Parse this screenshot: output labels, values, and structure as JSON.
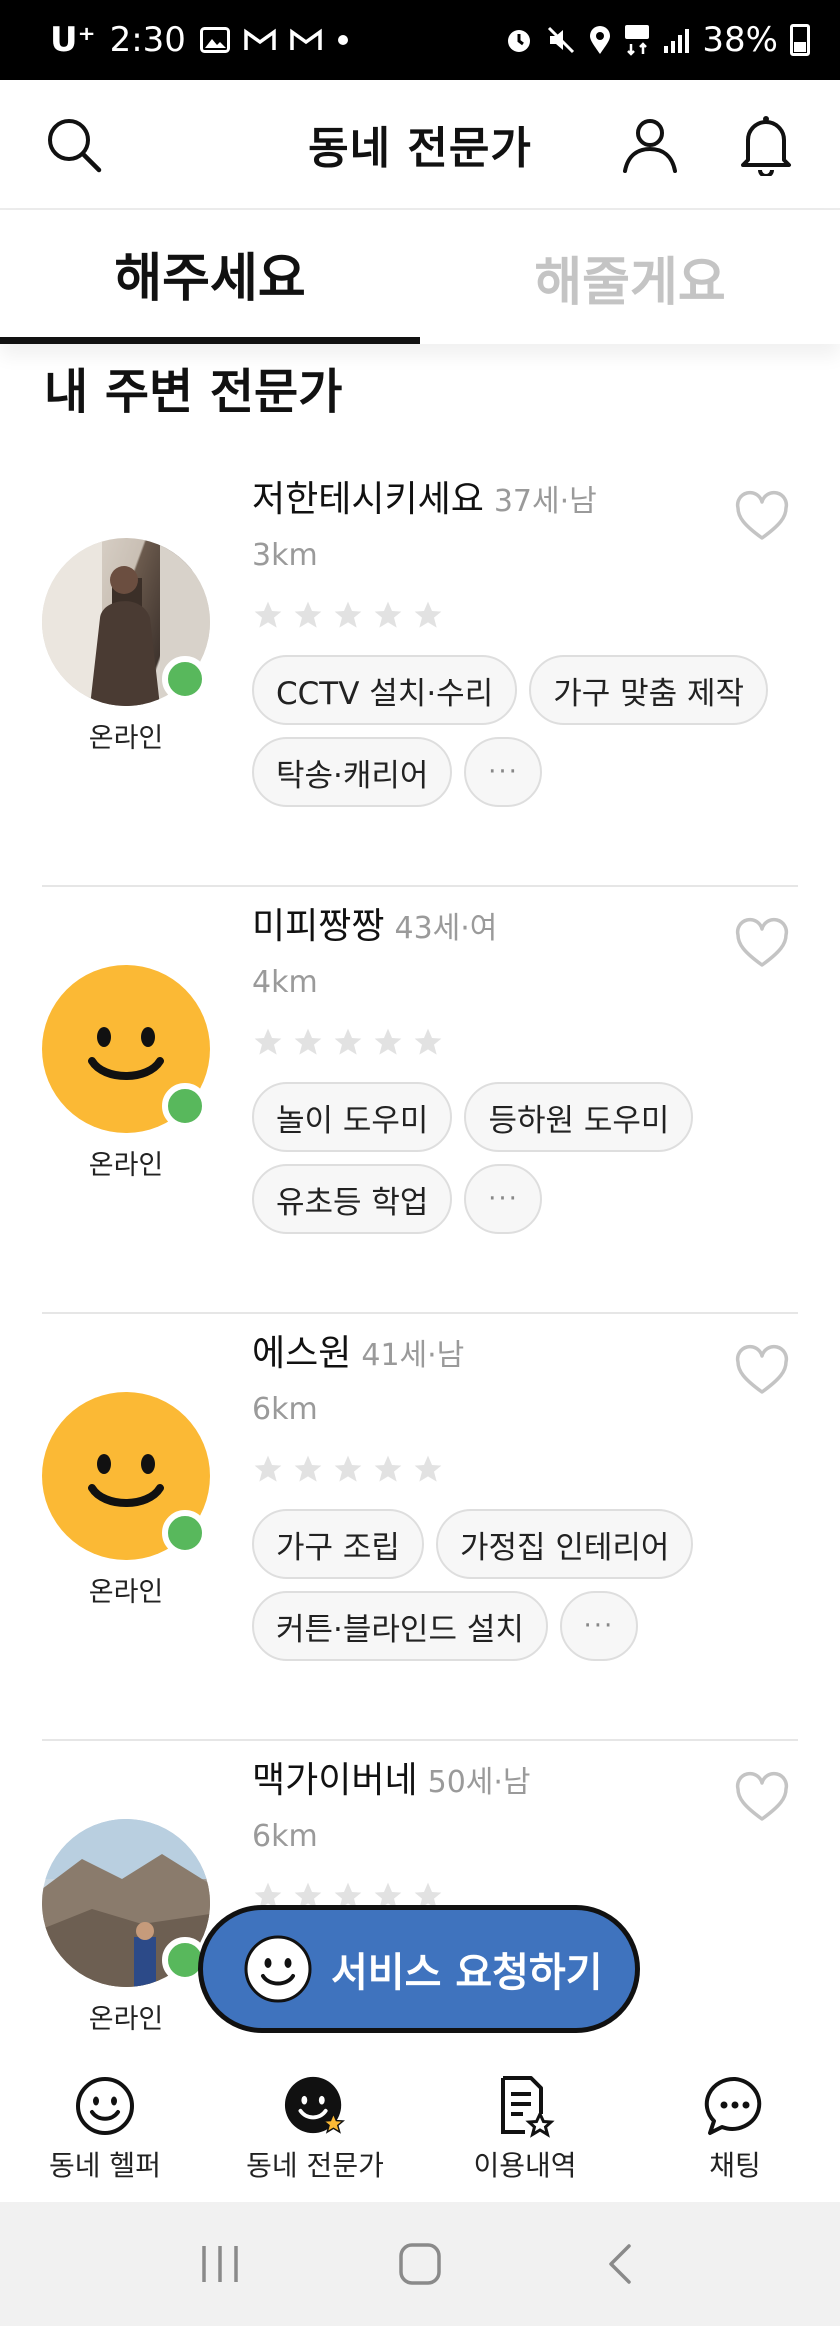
{
  "status_bar": {
    "carrier": "U⁺",
    "time": "2:30",
    "battery": "38%"
  },
  "header": {
    "title": "동네 전문가"
  },
  "tabs": [
    {
      "label": "해주세요",
      "active": true
    },
    {
      "label": "해줄게요",
      "active": false
    }
  ],
  "section_title": "내 주변 전문가",
  "experts": [
    {
      "name": "저한테시키세요",
      "meta": "37세·남",
      "distance": "3km",
      "status": "온라인",
      "avatar": "photo",
      "rating": 0,
      "chips": [
        "CCTV 설치·수리",
        "가구 맞춤 제작",
        "탁송·캐리어"
      ]
    },
    {
      "name": "미피짱짱",
      "meta": "43세·여",
      "distance": "4km",
      "status": "온라인",
      "avatar": "smile",
      "rating": 0,
      "chips": [
        "놀이 도우미",
        "등하원 도우미",
        "유초등 학업"
      ]
    },
    {
      "name": "에스원",
      "meta": "41세·남",
      "distance": "6km",
      "status": "온라인",
      "avatar": "smile",
      "rating": 0,
      "chips": [
        "가구 조립",
        "가정집 인테리어",
        "커튼·블라인드 설치"
      ]
    },
    {
      "name": "맥가이버네",
      "meta": "50세·남",
      "distance": "6km",
      "status": "온라인",
      "avatar": "photo",
      "rating": 0,
      "chips": []
    }
  ],
  "more_chip": "···",
  "fab": {
    "label": "서비스 요청하기"
  },
  "bottom_nav": [
    {
      "label": "동네 헬퍼",
      "icon": "smile-outline-icon"
    },
    {
      "label": "동네 전문가",
      "icon": "smile-filled-star-icon"
    },
    {
      "label": "이용내역",
      "icon": "document-star-icon"
    },
    {
      "label": "채팅",
      "icon": "chat-bubble-icon"
    }
  ],
  "colors": {
    "accent_blue": "#3f73be",
    "online_green": "#58b85c",
    "avatar_yellow": "#fbb935",
    "muted_text": "#9a9a9a"
  }
}
